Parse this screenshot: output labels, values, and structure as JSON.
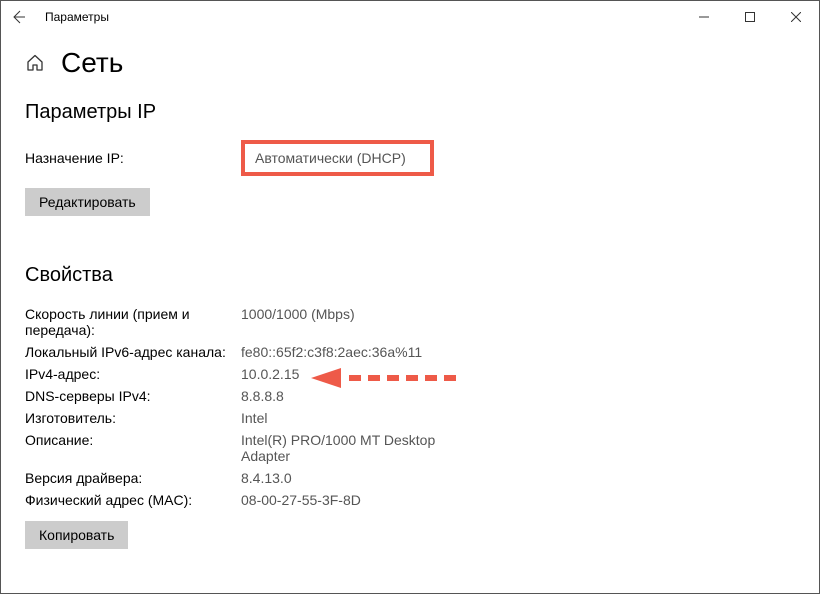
{
  "window": {
    "title": "Параметры"
  },
  "page": {
    "title": "Сеть"
  },
  "ip_section": {
    "heading": "Параметры IP",
    "assignment_label": "Назначение IP:",
    "assignment_value": "Автоматически (DHCP)",
    "edit_button": "Редактировать"
  },
  "props_section": {
    "heading": "Свойства",
    "rows": [
      {
        "label": "Скорость линии (прием и передача):",
        "value": "1000/1000 (Mbps)"
      },
      {
        "label": "Локальный IPv6-адрес канала:",
        "value": "fe80::65f2:c3f8:2aec:36a%11"
      },
      {
        "label": "IPv4-адрес:",
        "value": "10.0.2.15"
      },
      {
        "label": "DNS-серверы IPv4:",
        "value": "8.8.8.8"
      },
      {
        "label": "Изготовитель:",
        "value": "Intel"
      },
      {
        "label": "Описание:",
        "value": "Intel(R) PRO/1000 MT Desktop Adapter"
      },
      {
        "label": "Версия драйвера:",
        "value": "8.4.13.0"
      },
      {
        "label": "Физический адрес (MAC):",
        "value": "08-00-27-55-3F-8D"
      }
    ],
    "copy_button": "Копировать"
  },
  "annotation": {
    "highlight_color": "#ee5a48",
    "arrow_color": "#ee5a48"
  }
}
